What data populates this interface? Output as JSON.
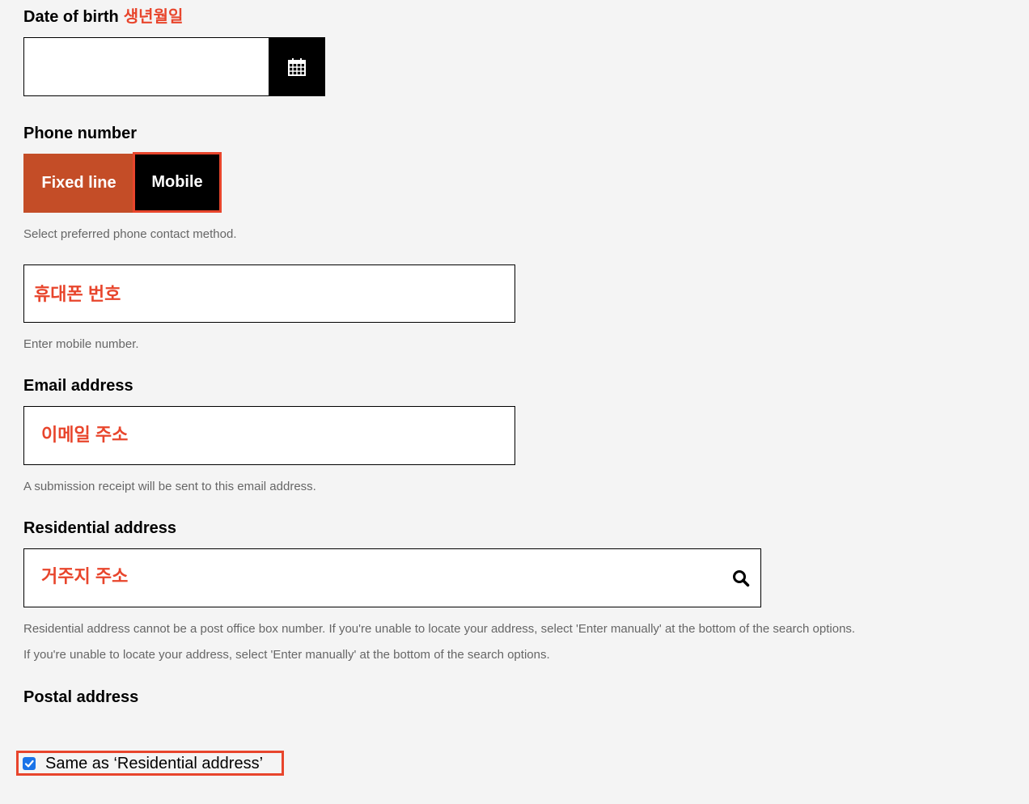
{
  "dob": {
    "label": "Date of birth",
    "label_kr": "생년월일",
    "calendar_icon": "calendar-icon"
  },
  "phone": {
    "label": "Phone number",
    "options": [
      "Fixed line",
      "Mobile"
    ],
    "selected": "Mobile",
    "hint": "Select preferred phone contact method.",
    "input_value": "휴대폰 번호",
    "input_hint": "Enter mobile number."
  },
  "email": {
    "label": "Email address",
    "input_value": "이메일 주소",
    "hint": "A submission receipt will be sent to this email address."
  },
  "residential": {
    "label": "Residential address",
    "input_value": "거주지 주소",
    "search_icon": "search-icon",
    "hint1": "Residential address cannot be a post office box number. If you're unable to locate your address, select 'Enter manually' at the bottom of the search options.",
    "hint2": "If you're unable to locate your address, select 'Enter manually' at the bottom of the search options."
  },
  "postal": {
    "label": "Postal address",
    "same_as_label": "Same as ‘Residential address’",
    "same_as_checked": true
  },
  "colors": {
    "accent": "#e8452c",
    "fixed_line_bg": "#c44d27",
    "checkbox": "#1a73e8"
  }
}
